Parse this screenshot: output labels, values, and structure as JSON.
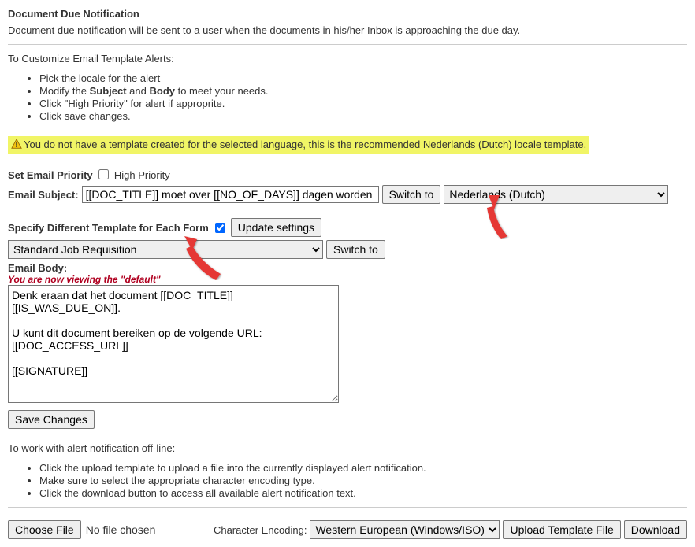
{
  "header": {
    "title": "Document Due Notification",
    "description": "Document due notification will be sent to a user when the documents in his/her Inbox is approaching the due day."
  },
  "customize": {
    "intro": "To Customize Email Template Alerts:",
    "items": {
      "0": "Pick the locale for the alert",
      "1_pre": "Modify the ",
      "1_b1": "Subject",
      "1_mid": " and ",
      "1_b2": "Body",
      "1_post": " to meet your needs.",
      "2": "Click \"High Priority\" for alert if approprite.",
      "3": "Click save changes."
    }
  },
  "banner": {
    "text": "You do not have a template created for the selected language, this is the recommended Nederlands (Dutch) locale template."
  },
  "priority": {
    "label": "Set Email Priority",
    "checkbox_label": "High Priority"
  },
  "subject": {
    "label": "Email Subject:",
    "value": "[[DOC_TITLE]] moet over [[NO_OF_DAYS]] dagen worden g",
    "switch_label": "Switch to",
    "locale_selected": "Nederlands (Dutch)"
  },
  "specify": {
    "label": "Specify Different Template for Each Form",
    "update_label": "Update settings",
    "form_selected": "Standard Job Requisition",
    "switch_label": "Switch to"
  },
  "body": {
    "label": "Email Body:",
    "default_note": "You are now viewing the \"default\"",
    "value": "Denk eraan dat het document [[DOC_TITLE]]\n[[IS_WAS_DUE_ON]].\n\nU kunt dit document bereiken op de volgende URL:\n[[DOC_ACCESS_URL]]\n\n[[SIGNATURE]]"
  },
  "save": {
    "label": "Save Changes"
  },
  "offline": {
    "intro": "To work with alert notification off-line:",
    "items": {
      "0": "Click the upload template to upload a file into the currently displayed alert notification.",
      "1": "Make sure to select the appropriate character encoding type.",
      "2": "Click the download button to access all available alert notification text."
    }
  },
  "file": {
    "choose_label": "Choose File",
    "no_file": "No file chosen",
    "encoding_label": "Character Encoding:",
    "encoding_selected": "Western European (Windows/ISO)",
    "upload_label": "Upload Template File",
    "download_label": "Download"
  }
}
